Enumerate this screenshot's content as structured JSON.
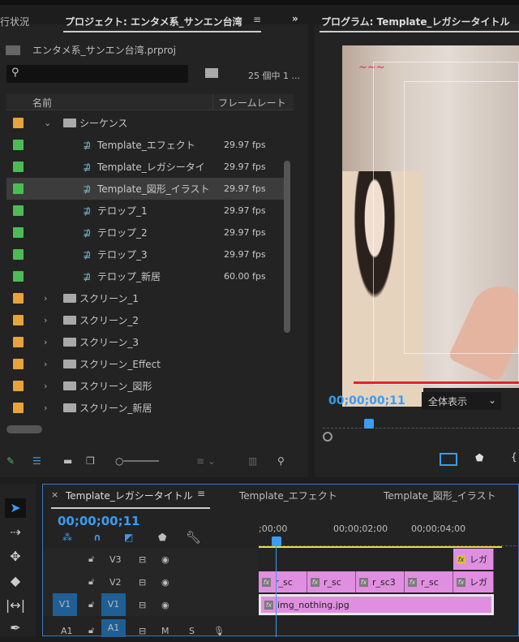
{
  "project_panel": {
    "prev_tab": "行状況",
    "tab": "プロジェクト: エンタメ系_サンエン台湾",
    "file": "エンタメ系_サンエン台湾.prproj",
    "search_placeholder": "",
    "count": "25 個中 1 ...",
    "col_name": "名前",
    "col_fps": "フレームレート",
    "items": [
      {
        "name": "シーケンス",
        "type": "folder",
        "color": "#e8a33c",
        "fps": "",
        "expanded": true
      },
      {
        "name": "Template_エフェクト",
        "type": "sequence",
        "color": "#4cbb56",
        "fps": "29.97 fps"
      },
      {
        "name": "Template_レガシータイ",
        "type": "sequence",
        "color": "#4cbb56",
        "fps": "29.97 fps"
      },
      {
        "name": "Template_図形_イラスト",
        "type": "sequence",
        "color": "#4cbb56",
        "fps": "29.97 fps",
        "selected": true
      },
      {
        "name": "テロップ_1",
        "type": "sequence",
        "color": "#4cbb56",
        "fps": "29.97 fps"
      },
      {
        "name": "テロップ_2",
        "type": "sequence",
        "color": "#4cbb56",
        "fps": "29.97 fps"
      },
      {
        "name": "テロップ_3",
        "type": "sequence",
        "color": "#4cbb56",
        "fps": "29.97 fps"
      },
      {
        "name": "テロップ_新居",
        "type": "sequence",
        "color": "#4cbb56",
        "fps": "60.00 fps"
      },
      {
        "name": "スクリーン_1",
        "type": "folder",
        "color": "#e8a33c",
        "fps": ""
      },
      {
        "name": "スクリーン_2",
        "type": "folder",
        "color": "#e8a33c",
        "fps": ""
      },
      {
        "name": "スクリーン_3",
        "type": "folder",
        "color": "#e8a33c",
        "fps": ""
      },
      {
        "name": "スクリーン_Effect",
        "type": "folder",
        "color": "#e8a33c",
        "fps": ""
      },
      {
        "name": "スクリーン_図形",
        "type": "folder",
        "color": "#e8a33c",
        "fps": ""
      },
      {
        "name": "スクリーン_新居",
        "type": "folder",
        "color": "#e8a33c",
        "fps": ""
      }
    ]
  },
  "program": {
    "tab": "プログラム: Template_レガシータイトル",
    "timecode": "00;00;00;11",
    "zoom": "全体表示"
  },
  "timeline": {
    "tabs": [
      "Template_レガシータイトル",
      "Template_エフェクト",
      "Template_図形_イラスト"
    ],
    "timecode": "00;00;00;11",
    "ruler": [
      ";00;00",
      "00;00;02;00",
      "00;00;04;00"
    ],
    "tracks": [
      {
        "name": "V3",
        "src": ""
      },
      {
        "name": "V2",
        "src": ""
      },
      {
        "name": "V1",
        "src": "V1"
      },
      {
        "name": "A1",
        "src": "A1"
      }
    ],
    "audio_m": "M",
    "audio_s": "S",
    "clips_v3": [
      "レガ"
    ],
    "clips_v2": [
      "r_sc",
      "r_sc",
      "r_sc3",
      "r_sc",
      "レガ"
    ],
    "clips_v1": [
      "img_nothing.jpg"
    ]
  },
  "accent": "#3b9cf0"
}
